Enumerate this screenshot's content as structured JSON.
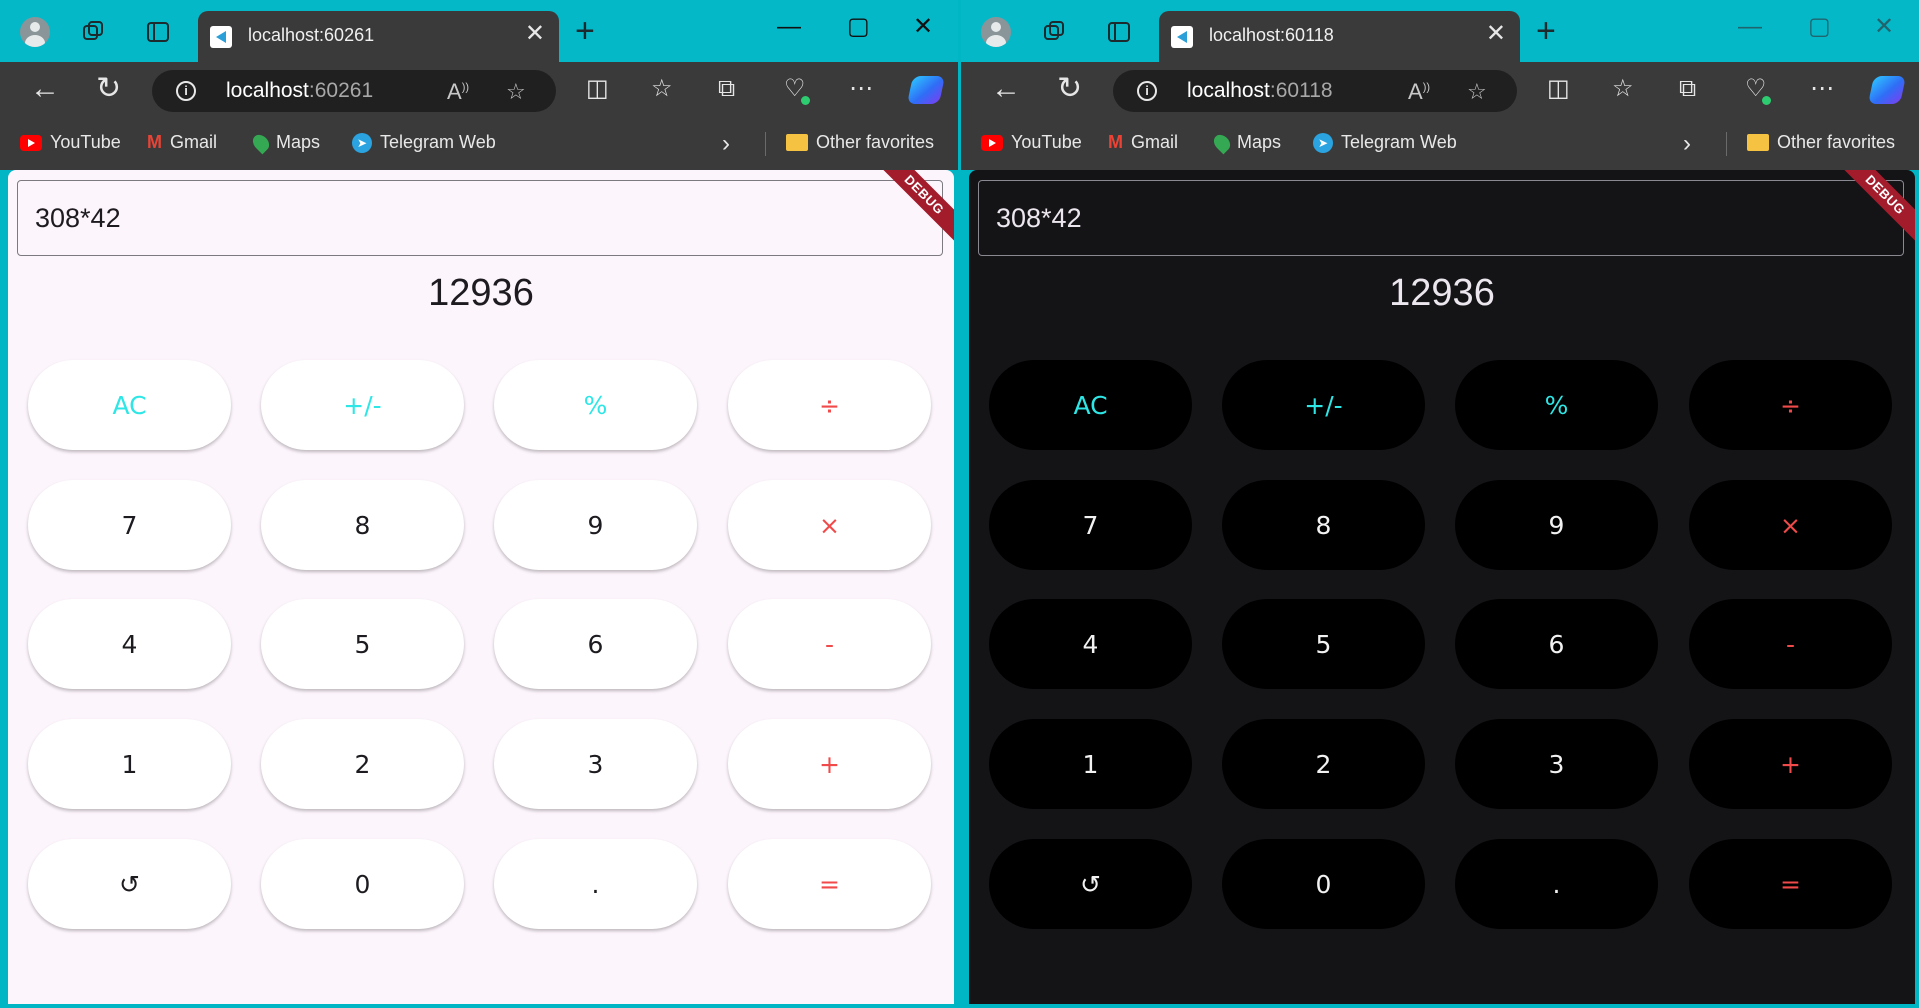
{
  "windows": [
    {
      "theme": "light",
      "tab_title": "localhost:60261",
      "url_host": "localhost",
      "url_port": ":60261",
      "expression": "308*42",
      "result": "12936",
      "debug_label": "DEBUG"
    },
    {
      "theme": "dark",
      "tab_title": "localhost:60118",
      "url_host": "localhost",
      "url_port": ":60118",
      "expression": "308*42",
      "result": "12936",
      "debug_label": "DEBUG"
    }
  ],
  "bookmarks": {
    "youtube": "YouTube",
    "gmail": "Gmail",
    "maps": "Maps",
    "telegram": "Telegram Web",
    "other": "Other favorites"
  },
  "keypad": {
    "ac": "AC",
    "plus_minus": "+/-",
    "percent": "%",
    "divide": "÷",
    "seven": "7",
    "eight": "8",
    "nine": "9",
    "multiply": "×",
    "four": "4",
    "five": "5",
    "six": "6",
    "minus": "-",
    "one": "1",
    "two": "2",
    "three": "3",
    "plus": "+",
    "undo": "↺",
    "zero": "0",
    "decimal": ".",
    "equals": "="
  },
  "colors": {
    "function_key": "#2ee6e6",
    "operator_key": "#f04a4a",
    "light_background": "#fdf5fc",
    "dark_background": "#141316",
    "browser_frame": "#05b8c8",
    "debug_ribbon": "#a21c2c"
  },
  "icons": {
    "profile": "avatar-icon",
    "workspaces": "workspaces-icon",
    "tab_actions": "vertical-tabs-icon",
    "favicon": "flutter-icon",
    "back": "back-arrow-icon",
    "refresh": "refresh-icon",
    "site_info": "info-icon",
    "read_aloud": "read-aloud-icon",
    "favorite": "star-icon"
  }
}
